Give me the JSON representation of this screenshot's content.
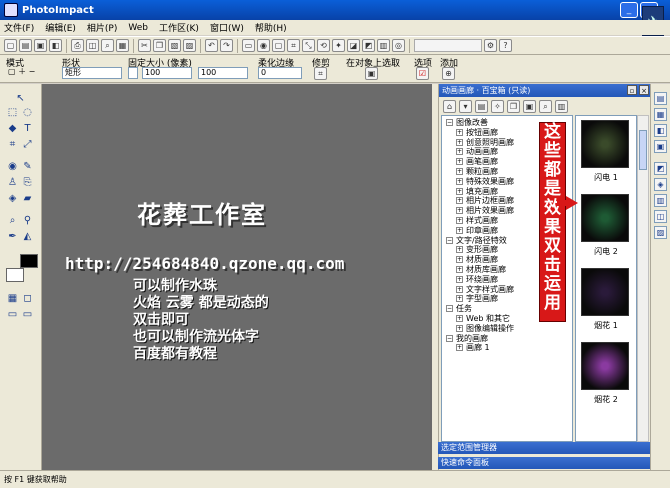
{
  "window": {
    "title": "PhotoImpact"
  },
  "menu": [
    "文件(F)",
    "编辑(E)",
    "相片(P)",
    "Web",
    "工作区(K)",
    "窗口(W)",
    "帮助(H)"
  ],
  "options": {
    "mode_label": "模式",
    "shape_label": "形状",
    "shape_value": "矩形",
    "fixed_size_label": "固定大小 (像素)",
    "width_value": "100",
    "height_value": "100",
    "soften_label": "柔化边缘",
    "soften_value": "0",
    "trim_label": "修剪",
    "select_on_object_label": "在对象上选取",
    "options_label": "选项",
    "add_label": "添加"
  },
  "canvas": {
    "studio": "花葬工作室",
    "url": "http://254684840.qzone.qq.com",
    "lines": [
      "可以制作水珠",
      "火焰 云雾 都是动态的",
      "双击即可",
      "也可以制作流光体字",
      "百度都有教程"
    ]
  },
  "right_panel": {
    "title": "动画画廊 · 百宝箱 (只读)",
    "tree": [
      {
        "label": "图像改善",
        "level": 0,
        "sign": "−"
      },
      {
        "label": "按钮画廊",
        "level": 1,
        "sign": "+"
      },
      {
        "label": "创意照明画廊",
        "level": 1,
        "sign": "+"
      },
      {
        "label": "动画画廊",
        "level": 1,
        "sign": "+"
      },
      {
        "label": "画笔画廊",
        "level": 1,
        "sign": "+"
      },
      {
        "label": "颗粒画廊",
        "level": 1,
        "sign": "+"
      },
      {
        "label": "特殊效果画廊",
        "level": 1,
        "sign": "+"
      },
      {
        "label": "填充画廊",
        "level": 1,
        "sign": "+"
      },
      {
        "label": "相片边框画廊",
        "level": 1,
        "sign": "+"
      },
      {
        "label": "相片效果画廊",
        "level": 1,
        "sign": "+"
      },
      {
        "label": "样式画廊",
        "level": 1,
        "sign": "+"
      },
      {
        "label": "印章画廊",
        "level": 1,
        "sign": "+"
      },
      {
        "label": "文字/路径特效",
        "level": 0,
        "sign": "−"
      },
      {
        "label": "变形画廊",
        "level": 1,
        "sign": "+"
      },
      {
        "label": "材质画廊",
        "level": 1,
        "sign": "+"
      },
      {
        "label": "材质库画廊",
        "level": 1,
        "sign": "+"
      },
      {
        "label": "环绕画廊",
        "level": 1,
        "sign": "+"
      },
      {
        "label": "文字样式画廊",
        "level": 1,
        "sign": "+"
      },
      {
        "label": "字型画廊",
        "level": 1,
        "sign": "+"
      },
      {
        "label": "任务",
        "level": 0,
        "sign": "−"
      },
      {
        "label": "Web 和其它",
        "level": 1,
        "sign": "+"
      },
      {
        "label": "图像编辑操作",
        "level": 1,
        "sign": "+"
      },
      {
        "label": "我的画廊",
        "level": 0,
        "sign": "−"
      },
      {
        "label": "画廊 1",
        "level": 1,
        "sign": "+"
      }
    ],
    "thumbs": [
      {
        "label": "闪电 1",
        "color": "#3a4a2a"
      },
      {
        "label": "闪电 2",
        "color": "#1e5a34"
      },
      {
        "label": "烟花 1",
        "color": "#2a1a3a"
      },
      {
        "label": "烟花 2",
        "color": "#8a3aa0"
      }
    ],
    "banner": "这些都是效果双击运用"
  },
  "bottom_panels": [
    "选定范围管理器",
    "快速命令面板"
  ],
  "status": "按 F1 键获取帮助"
}
